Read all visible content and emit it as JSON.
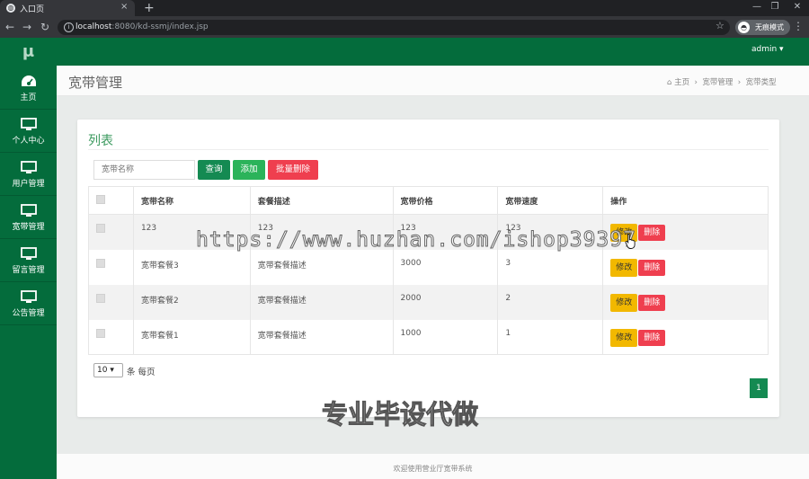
{
  "browser": {
    "tab_title": "入口页",
    "url_host": "localhost",
    "url_path": ":8080/kd-ssmj/index.jsp",
    "profile_label": "无痕模式",
    "new_tab": "+",
    "tab_close": "×",
    "window_buttons": [
      "—",
      "❐",
      "✕"
    ],
    "nav_glyphs": {
      "back": "←",
      "forward": "→",
      "reload": "↻",
      "star": "☆",
      "menu": "⋮",
      "info": "i"
    }
  },
  "app": {
    "logo": "μ",
    "user_menu": "admin ▾",
    "sidebar": [
      {
        "label": "主页",
        "icon": "dashboard-icon"
      },
      {
        "label": "个人中心",
        "icon": "monitor-icon"
      },
      {
        "label": "用户管理",
        "icon": "monitor-icon"
      },
      {
        "label": "宽带管理",
        "icon": "monitor-icon"
      },
      {
        "label": "留言管理",
        "icon": "monitor-icon"
      },
      {
        "label": "公告管理",
        "icon": "monitor-icon"
      }
    ],
    "page_title": "宽带管理",
    "breadcrumb": [
      "主页",
      "宽带管理",
      "宽带类型"
    ],
    "breadcrumb_home_icon": "home-icon",
    "breadcrumb_sep": ">",
    "list_title": "列表",
    "search_placeholder": "宽带名称",
    "buttons": {
      "query": "查询",
      "add": "添加",
      "batch_delete": "批量删除",
      "edit": "修改",
      "delete": "删除"
    },
    "table": {
      "headers": [
        "宽带名称",
        "套餐描述",
        "宽带价格",
        "宽带速度",
        "操作"
      ],
      "rows": [
        {
          "name": "123",
          "desc": "123",
          "price": "123",
          "speed": "123"
        },
        {
          "name": "宽带套餐3",
          "desc": "宽带套餐描述",
          "price": "3000",
          "speed": "3"
        },
        {
          "name": "宽带套餐2",
          "desc": "宽带套餐描述",
          "price": "2000",
          "speed": "2"
        },
        {
          "name": "宽带套餐1",
          "desc": "宽带套餐描述",
          "price": "1000",
          "speed": "1"
        }
      ]
    },
    "page_size": "10",
    "page_size_label": "条 每页",
    "current_page": "1",
    "footer": "欢迎使用营业厅宽带系统"
  },
  "watermarks": {
    "url": "https://www.huzhan.com/ishop39397",
    "promo": "专业毕设代做"
  },
  "colors": {
    "primary_green": "#046c3c",
    "button_green": "#148a52",
    "add_green": "#2bb35a",
    "danger_red": "#ef3f4f",
    "warning_yellow": "#f2b800"
  }
}
